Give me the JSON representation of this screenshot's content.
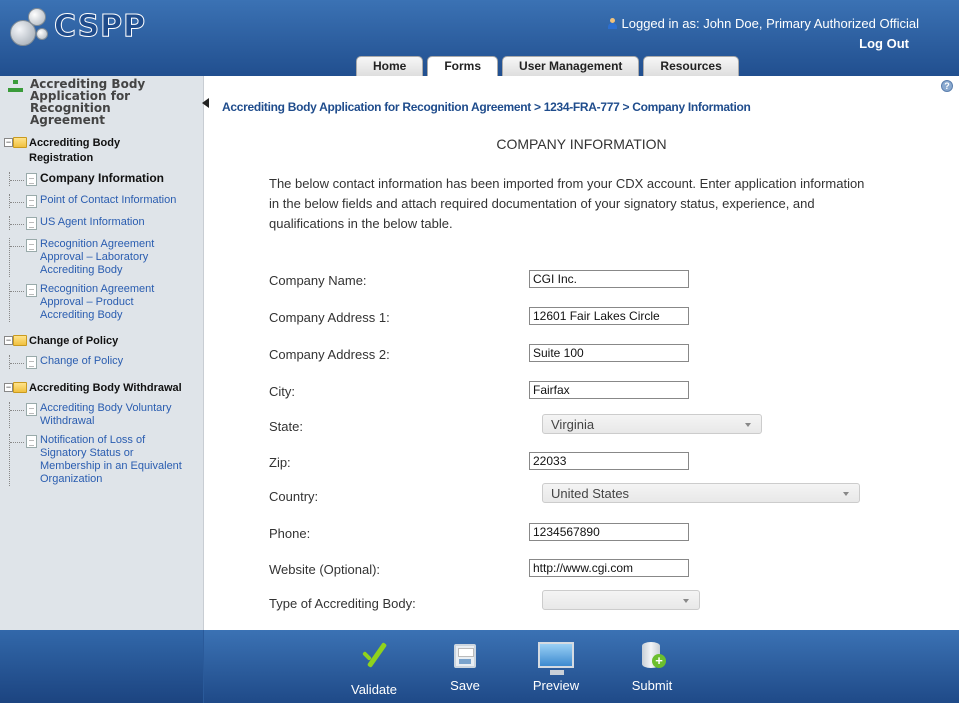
{
  "header": {
    "logo_text": "CSPP",
    "logged_in": "Logged in as: John Doe, Primary Authorized Official",
    "logout": "Log Out",
    "tabs": [
      {
        "label": "Home"
      },
      {
        "label": "Forms"
      },
      {
        "label": "User Management"
      },
      {
        "label": "Resources"
      }
    ],
    "active_tab": "Forms"
  },
  "sidebar": {
    "title": "Accrediting Body Application for Recognition Agreement",
    "groups": [
      {
        "label": "Accrediting Body Registration",
        "items": [
          {
            "label": "Company Information"
          },
          {
            "label": "Point of Contact Information"
          },
          {
            "label": "US Agent Information"
          },
          {
            "label": "Recognition Agreement Approval – Laboratory Accrediting Body"
          },
          {
            "label": "Recognition Agreement Approval – Product Accrediting Body"
          }
        ]
      },
      {
        "label": "Change of Policy",
        "items": [
          {
            "label": "Change of Policy"
          }
        ]
      },
      {
        "label": "Accrediting Body Withdrawal",
        "items": [
          {
            "label": "Accrediting Body Voluntary Withdrawal"
          },
          {
            "label": "Notification of Loss of Signatory Status or Membership in an Equivalent Organization"
          }
        ]
      }
    ]
  },
  "main": {
    "breadcrumb": "Accrediting Body Application for Recognition Agreement > 1234-FRA-777 > Company Information",
    "title": "COMPANY INFORMATION",
    "intro": "The below contact information has been imported from your CDX account. Enter application information in the below fields and attach required documentation of your signatory status, experience, and qualifications in the below table.",
    "fields": [
      {
        "label": "Company Name:",
        "value": "CGI Inc."
      },
      {
        "label": "Company Address 1:",
        "value": "12601 Fair Lakes Circle"
      },
      {
        "label": "Company Address 2:",
        "value": "Suite 100"
      },
      {
        "label": "City:",
        "value": "Fairfax"
      },
      {
        "label": "State:",
        "value": "Virginia"
      },
      {
        "label": "Zip:",
        "value": "22033"
      },
      {
        "label": "Country:",
        "value": "United States"
      },
      {
        "label": "Phone:",
        "value": "1234567890"
      },
      {
        "label": "Website (Optional):",
        "value": "http://www.cgi.com"
      },
      {
        "label": "Type of Accrediting Body:",
        "value": ""
      }
    ]
  },
  "footer": {
    "actions": [
      {
        "label": "Validate",
        "icon": "check-icon"
      },
      {
        "label": "Save",
        "icon": "save-icon"
      },
      {
        "label": "Preview",
        "icon": "monitor-icon"
      },
      {
        "label": "Submit",
        "icon": "database-add-icon"
      }
    ]
  },
  "colors": {
    "header_blue": "#2d63a6",
    "link_blue": "#1f4c8c",
    "sidebar_bg": "#dfe4e9",
    "check_green": "#8fd21d"
  }
}
